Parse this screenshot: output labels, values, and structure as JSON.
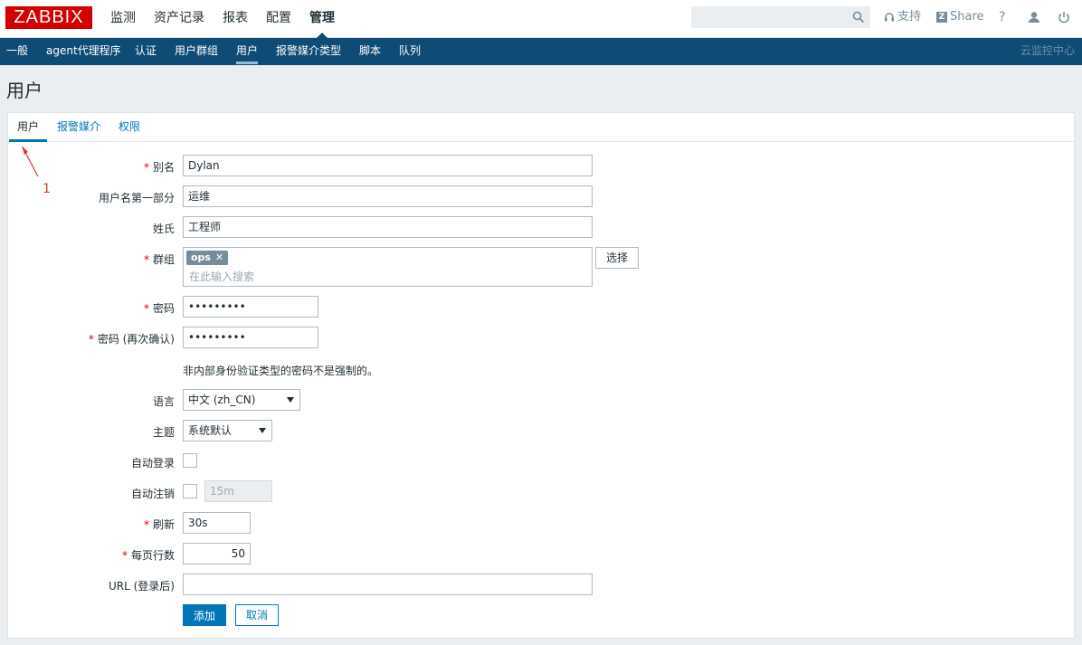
{
  "app": {
    "logo": "ZABBIX"
  },
  "mainnav": [
    "监测",
    "资产记录",
    "报表",
    "配置",
    "管理"
  ],
  "topright": {
    "support": "支持",
    "share": "Share",
    "help": "?"
  },
  "subnav": [
    "一般",
    "agent代理程序",
    "认证",
    "用户群组",
    "用户",
    "报警媒介类型",
    "脚本",
    "队列"
  ],
  "subnav_right": "云监控中心",
  "page_title": "用户",
  "tabs": [
    "用户",
    "报警媒介",
    "权限"
  ],
  "annotation": "1",
  "form": {
    "alias": {
      "label": "别名",
      "value": "Dylan"
    },
    "name": {
      "label": "用户名第一部分",
      "value": "运维"
    },
    "surname": {
      "label": "姓氏",
      "value": "工程师"
    },
    "groups": {
      "label": "群组",
      "chip": "ops",
      "placeholder": "在此输入搜索",
      "select_btn": "选择"
    },
    "password": {
      "label": "密码",
      "value": "•••••••••"
    },
    "password2": {
      "label": "密码 (再次确认)",
      "value": "•••••••••"
    },
    "password_note": "非内部身份验证类型的密码不是强制的。",
    "lang": {
      "label": "语言",
      "value": "中文 (zh_CN)"
    },
    "theme": {
      "label": "主题",
      "value": "系统默认"
    },
    "autologin": {
      "label": "自动登录"
    },
    "autologout": {
      "label": "自动注销",
      "value": "15m"
    },
    "refresh": {
      "label": "刷新",
      "value": "30s"
    },
    "rows": {
      "label": "每页行数",
      "value": "50"
    },
    "url": {
      "label": "URL (登录后)",
      "value": ""
    },
    "add_btn": "添加",
    "cancel_btn": "取消"
  },
  "colors": {
    "brand": "#d40000",
    "nav": "#0e4c75",
    "accent": "#0275b8",
    "required": "#d40000"
  }
}
